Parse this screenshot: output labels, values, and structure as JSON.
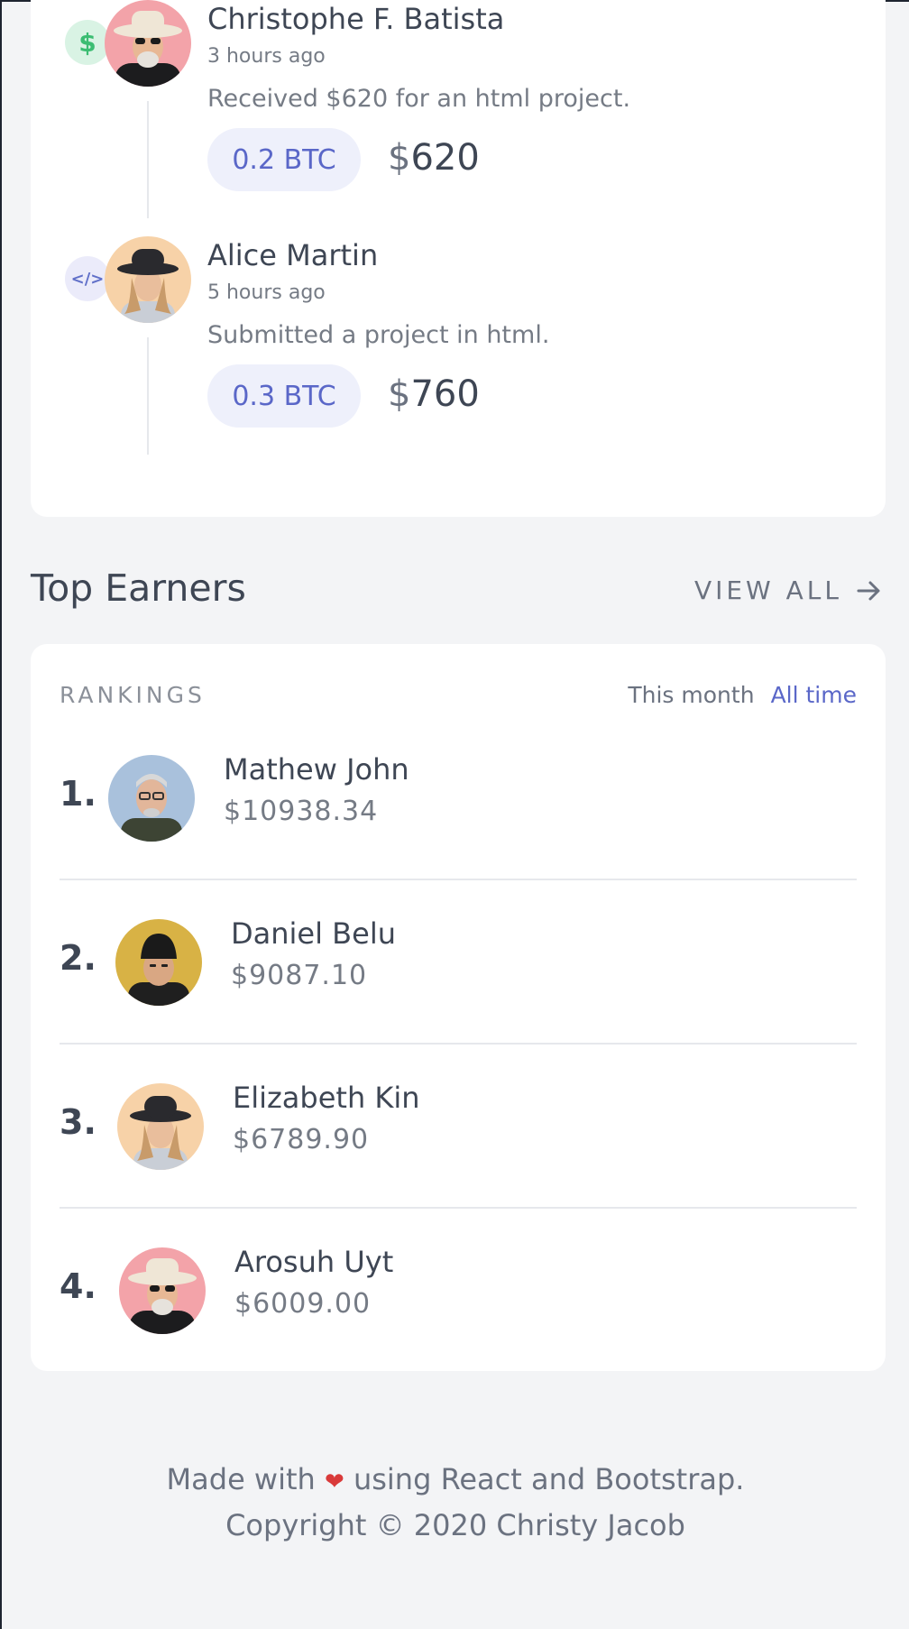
{
  "activity": {
    "items": [
      {
        "badge": "$",
        "name": "Christophe F. Batista",
        "time": "3 hours ago",
        "description": "Received $620 for an html project.",
        "btc": "0.2 BTC",
        "currency": "$",
        "amount": "620"
      },
      {
        "badge": "</>",
        "name": "Alice Martin",
        "time": "5 hours ago",
        "description": "Submitted a project in html.",
        "btc": "0.3 BTC",
        "currency": "$",
        "amount": "760"
      }
    ]
  },
  "top_earners": {
    "title": "Top Earners",
    "view_all": "VIEW ALL",
    "rankings_label": "RANKINGS",
    "filters": [
      "This month",
      "All time"
    ],
    "active_filter": "All time",
    "rows": [
      {
        "rank": "1.",
        "name": "Mathew John",
        "amount": "$10938.34"
      },
      {
        "rank": "2.",
        "name": "Daniel Belu",
        "amount": "$9087.10"
      },
      {
        "rank": "3.",
        "name": "Elizabeth Kin",
        "amount": "$6789.90"
      },
      {
        "rank": "4.",
        "name": "Arosuh Uyt",
        "amount": "$6009.00"
      }
    ]
  },
  "footer": {
    "made_with": "Made with",
    "using": "using React and Bootstrap.",
    "copyright": "Copyright © 2020 Christy Jacob"
  },
  "colors": {
    "accent": "#5a67c8",
    "money_green": "#3bbd72",
    "heart": "#d93a3a"
  },
  "icons": [
    "dollar-icon",
    "code-icon",
    "arrow-right-icon",
    "heart-icon"
  ]
}
